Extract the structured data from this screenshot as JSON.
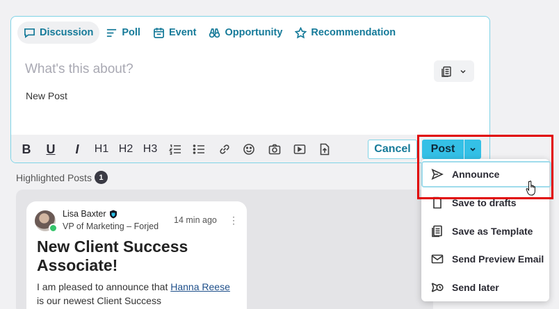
{
  "composer": {
    "tabs": [
      {
        "label": "Discussion",
        "icon": "chat-bubble-icon",
        "active": true
      },
      {
        "label": "Poll",
        "icon": "poll-bars-icon",
        "active": false
      },
      {
        "label": "Event",
        "icon": "calendar-icon",
        "active": false
      },
      {
        "label": "Opportunity",
        "icon": "binoculars-icon",
        "active": false
      },
      {
        "label": "Recommendation",
        "icon": "star-icon",
        "active": false
      }
    ],
    "title_placeholder": "What's this about?",
    "body_text": "New Post",
    "toolbar": {
      "bold": "B",
      "underline": "U",
      "italic": "I",
      "h1": "H1",
      "h2": "H2",
      "h3": "H3",
      "cancel_label": "Cancel",
      "post_label": "Post"
    }
  },
  "highlighted": {
    "label": "Highlighted Posts",
    "count": "1"
  },
  "post_card": {
    "author": "Lisa Baxter",
    "role": "VP of Marketing – Forjed",
    "time": "14 min ago",
    "title": "New Client Success Associate!",
    "body_prefix": "I am pleased to announce that ",
    "body_link": "Hanna Reese",
    "body_suffix": " is our newest Client Success"
  },
  "post_menu": {
    "items": [
      {
        "label": "Announce",
        "icon": "send-icon"
      },
      {
        "label": "Save to drafts",
        "icon": "draft-icon"
      },
      {
        "label": "Save as Template",
        "icon": "template-icon"
      },
      {
        "label": "Send Preview Email",
        "icon": "email-icon"
      },
      {
        "label": "Send later",
        "icon": "schedule-send-icon"
      }
    ]
  },
  "colors": {
    "accent": "#157a99",
    "post_button": "#34c0e6",
    "highlight_frame": "#e10000"
  }
}
